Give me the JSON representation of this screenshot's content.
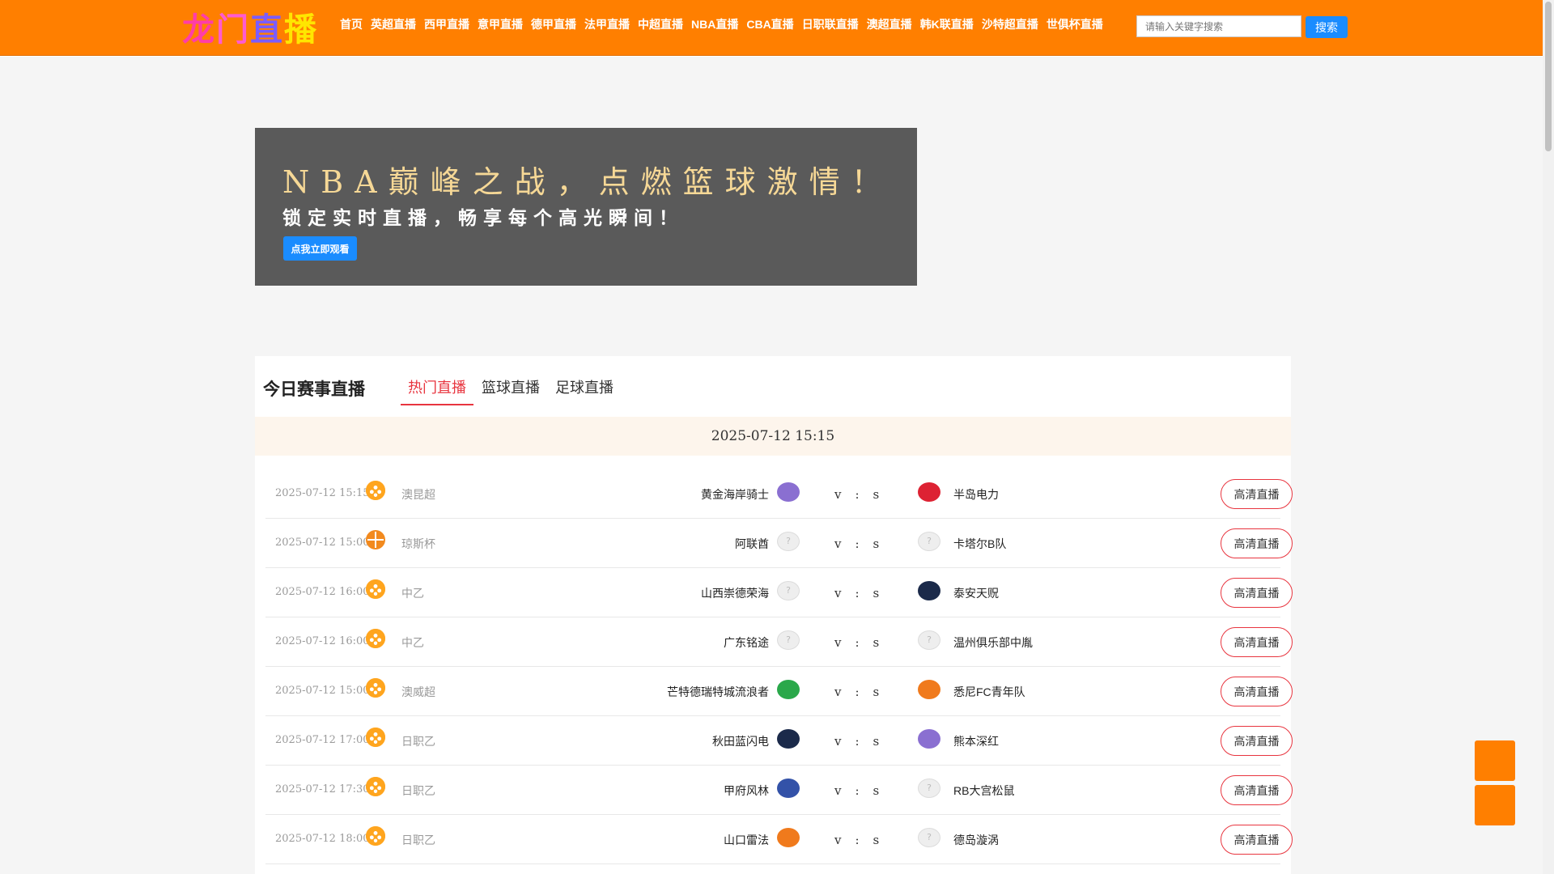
{
  "header": {
    "logo_chars": [
      "龙",
      "门",
      "直",
      "播"
    ],
    "nav": [
      "首页",
      "英超直播",
      "西甲直播",
      "意甲直播",
      "德甲直播",
      "法甲直播",
      "中超直播",
      "NBA直播",
      "CBA直播",
      "日职联直播",
      "澳超直播",
      "韩K联直播",
      "沙特超直播",
      "世俱杯直播"
    ],
    "search_placeholder": "请输入关键字搜索",
    "search_button": "搜索",
    "accent_color": "#ff7f00"
  },
  "banner": {
    "title": "NBA巅峰之战，点燃篮球激情！",
    "subtitle": "锁定实时直播，畅享每个高光瞬间！",
    "button": "点我立即观看"
  },
  "matches": {
    "section_title": "今日赛事直播",
    "tabs": [
      "热门直播",
      "篮球直播",
      "足球直播"
    ],
    "active_tab": "热门直播",
    "date_header": "2025-07-12 15:15",
    "vs_chars": [
      "v",
      ":",
      "s"
    ],
    "button_label": "高清直播",
    "rows": [
      {
        "time": "2025-07-12 15:15",
        "sport": "football",
        "league": "澳昆超",
        "home": "黄金海岸骑士",
        "away": "半岛电力",
        "home_logo": "crest",
        "away_logo": "crest"
      },
      {
        "time": "2025-07-12 15:00",
        "sport": "basketball",
        "league": "琼斯杯",
        "home": "阿联酋",
        "away": "卡塔尔B队",
        "home_logo": "unknown",
        "away_logo": "unknown"
      },
      {
        "time": "2025-07-12 16:00",
        "sport": "football",
        "league": "中乙",
        "home": "山西崇德荣海",
        "away": "泰安天贶",
        "home_logo": "unknown",
        "away_logo": "crest"
      },
      {
        "time": "2025-07-12 16:00",
        "sport": "football",
        "league": "中乙",
        "home": "广东铭途",
        "away": "温州俱乐部中胤",
        "home_logo": "unknown",
        "away_logo": "unknown"
      },
      {
        "time": "2025-07-12 15:00",
        "sport": "football",
        "league": "澳威超",
        "home": "芒特德瑞特城流浪者",
        "away": "悉尼FC青年队",
        "home_logo": "crest",
        "away_logo": "crest"
      },
      {
        "time": "2025-07-12 17:00",
        "sport": "football",
        "league": "日职乙",
        "home": "秋田蓝闪电",
        "away": "熊本深红",
        "home_logo": "crest",
        "away_logo": "crest"
      },
      {
        "time": "2025-07-12 17:30",
        "sport": "football",
        "league": "日职乙",
        "home": "甲府风林",
        "away": "RB大宫松鼠",
        "home_logo": "crest",
        "away_logo": "unknown"
      },
      {
        "time": "2025-07-12 18:00",
        "sport": "football",
        "league": "日职乙",
        "home": "山口雷法",
        "away": "德岛漩涡",
        "home_logo": "crest",
        "away_logo": "unknown"
      }
    ]
  }
}
